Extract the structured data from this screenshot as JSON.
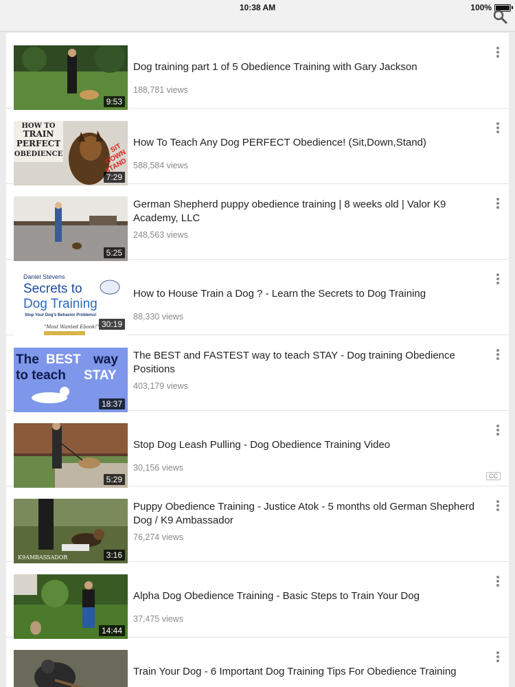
{
  "status_bar": {
    "time": "10:38 AM",
    "battery": "100%"
  },
  "icons": {
    "search": "search-icon",
    "more": "more-vertical-icon",
    "battery": "battery-icon"
  },
  "videos": [
    {
      "title": "Dog training part 1 of 5 Obedience Training with Gary Jackson",
      "views": "188,781 views",
      "duration": "9:53"
    },
    {
      "title": "How To Teach Any Dog PERFECT Obedience! (Sit,Down,Stand)",
      "views": "588,584 views",
      "duration": "7:29",
      "thumb_text": [
        "HOW TO",
        "TRAIN",
        "PERFECT",
        "OBEDIENCE",
        "SIT",
        "DOWN",
        "STAND"
      ]
    },
    {
      "title": "German Shepherd puppy obedience training | 8 weeks old | Valor K9 Academy, LLC",
      "views": "248,563 views",
      "duration": "5:25"
    },
    {
      "title": "How to House Train a Dog ? - Learn the Secrets to Dog Training",
      "views": "88,330 views",
      "duration": "30:19",
      "thumb_text": [
        "Daniel Stevens",
        "Secrets to",
        "Dog Training",
        "Stop Your Dog's Behavior Problems!",
        "\"Most Wanted Ebook!\""
      ]
    },
    {
      "title": "The BEST and FASTEST way to teach STAY - Dog training Obedience Positions",
      "views": "403,179 views",
      "duration": "18:37",
      "thumb_text": [
        "The",
        "BEST",
        "way",
        "to teach",
        "STAY"
      ]
    },
    {
      "title": "Stop Dog Leash Pulling - Dog Obedience Training Video",
      "views": "30,156 views",
      "duration": "5:29",
      "cc": "CC"
    },
    {
      "title": "Puppy Obedience Training - Justice Atok - 5 months old German Shepherd Dog / K9 Ambassador",
      "views": "76,274 views",
      "duration": "3:16",
      "thumb_text": [
        "K9AMBASSADOR"
      ]
    },
    {
      "title": "Alpha Dog Obedience Training - Basic Steps to Train Your Dog",
      "views": "37,475 views",
      "duration": "14:44"
    },
    {
      "title": "Train Your Dog - 6 Important Dog Training Tips For Obedience Training",
      "views": "",
      "duration": ""
    }
  ]
}
